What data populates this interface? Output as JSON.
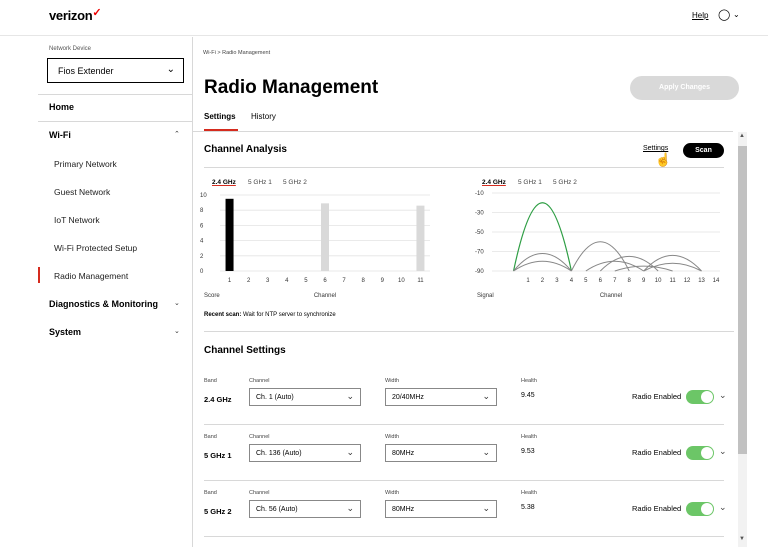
{
  "header": {
    "logo": "verizon",
    "logo_mark": "✓",
    "help": "Help",
    "user_icon": "user-circle-icon"
  },
  "sidebar": {
    "device_label": "Network Device",
    "device_value": "Fios Extender",
    "items": [
      {
        "label": "Home"
      },
      {
        "label": "Wi-Fi"
      },
      {
        "label": "Primary Network"
      },
      {
        "label": "Guest Network"
      },
      {
        "label": "IoT Network"
      },
      {
        "label": "Wi-Fi Protected Setup"
      },
      {
        "label": "Radio Management"
      },
      {
        "label": "Diagnostics & Monitoring"
      },
      {
        "label": "System"
      }
    ],
    "active": "Radio Management"
  },
  "breadcrumb": "Wi-Fi  >  Radio Management",
  "page_title": "Radio Management",
  "apply_label": "Apply Changes",
  "tabs": [
    {
      "label": "Settings"
    },
    {
      "label": "History"
    }
  ],
  "channel_analysis": {
    "title": "Channel Analysis",
    "settings_link": "Settings",
    "scan_label": "Scan",
    "left_bands": [
      "2.4 GHz",
      "5 GHz 1",
      "5 GHz 2"
    ],
    "right_bands": [
      "2.4 GHz",
      "5 GHz 1",
      "5 GHz 2"
    ],
    "recent_label": "Recent scan:",
    "recent_text": "Wait for NTP server to synchronize"
  },
  "chart_data": [
    {
      "type": "bar",
      "xlabel": "Channel",
      "ylabel": "Score",
      "categories": [
        "1",
        "2",
        "3",
        "4",
        "5",
        "6",
        "7",
        "8",
        "9",
        "10",
        "11"
      ],
      "values": [
        9.5,
        0,
        0,
        0,
        0,
        8.9,
        0,
        0,
        0,
        0,
        8.6
      ],
      "highlight": "1",
      "ylim": [
        0,
        10
      ],
      "yticks": [
        0,
        2,
        4,
        6,
        8,
        10
      ],
      "colors": {
        "active": "#000000",
        "other": "#d9d9d9"
      }
    },
    {
      "type": "line",
      "xlabel": "Channel",
      "ylabel": "Signal",
      "x": [
        "1",
        "2",
        "3",
        "4",
        "5",
        "6",
        "7",
        "8",
        "9",
        "10",
        "11",
        "12",
        "13",
        "14"
      ],
      "ylim": [
        -90,
        -10
      ],
      "yticks": [
        -10,
        -30,
        -50,
        -70,
        -90
      ],
      "series": [
        {
          "center": 2,
          "peak": -20,
          "color": "#2e9e44"
        },
        {
          "center": 2,
          "peak": -72,
          "color": "#888888"
        },
        {
          "center": 2,
          "peak": -80,
          "color": "#888888"
        },
        {
          "center": 6,
          "peak": -60,
          "color": "#888888"
        },
        {
          "center": 7,
          "peak": -80,
          "color": "#888888"
        },
        {
          "center": 8,
          "peak": -75,
          "color": "#888888"
        },
        {
          "center": 9,
          "peak": -85,
          "color": "#888888"
        },
        {
          "center": 11,
          "peak": -74,
          "color": "#888888"
        },
        {
          "center": 11,
          "peak": -82,
          "color": "#888888"
        }
      ]
    }
  ],
  "channel_settings": {
    "title": "Channel Settings",
    "col_band": "Band",
    "col_channel": "Channel",
    "col_width": "Width",
    "col_health": "Health",
    "rows": [
      {
        "band": "2.4 GHz",
        "channel": "Ch. 1 (Auto)",
        "width": "20/40MHz",
        "health": "9.45",
        "radio": "Radio Enabled"
      },
      {
        "band": "5 GHz 1",
        "channel": "Ch. 136 (Auto)",
        "width": "80MHz",
        "health": "9.53",
        "radio": "Radio Enabled"
      },
      {
        "band": "5 GHz 2",
        "channel": "Ch. 56 (Auto)",
        "width": "80MHz",
        "health": "5.38",
        "radio": "Radio Enabled"
      }
    ]
  }
}
